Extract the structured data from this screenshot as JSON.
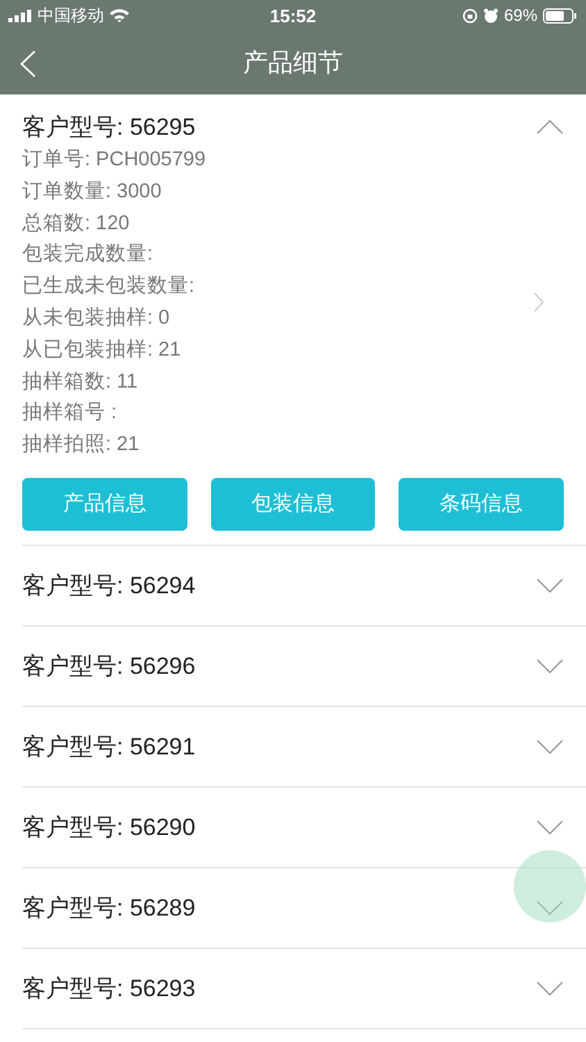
{
  "status_bar": {
    "carrier": "中国移动",
    "time": "15:52",
    "battery": "69%"
  },
  "nav": {
    "title": "产品细节"
  },
  "items": [
    {
      "title": "客户型号: 56295",
      "expanded": true,
      "details": [
        "订单号: PCH005799",
        "订单数量: 3000",
        "总箱数: 120",
        "包装完成数量:",
        "已生成未包装数量:",
        "从未包装抽样: 0",
        "从已包装抽样: 21",
        "抽样箱数: 11",
        "抽样箱号 :",
        "抽样拍照: 21"
      ],
      "buttons": [
        "产品信息",
        "包装信息",
        "条码信息"
      ]
    },
    {
      "title": "客户型号: 56294",
      "expanded": false
    },
    {
      "title": "客户型号: 56296",
      "expanded": false
    },
    {
      "title": "客户型号: 56291",
      "expanded": false
    },
    {
      "title": "客户型号: 56290",
      "expanded": false
    },
    {
      "title": "客户型号: 56289",
      "expanded": false
    },
    {
      "title": "客户型号: 56293",
      "expanded": false
    }
  ]
}
